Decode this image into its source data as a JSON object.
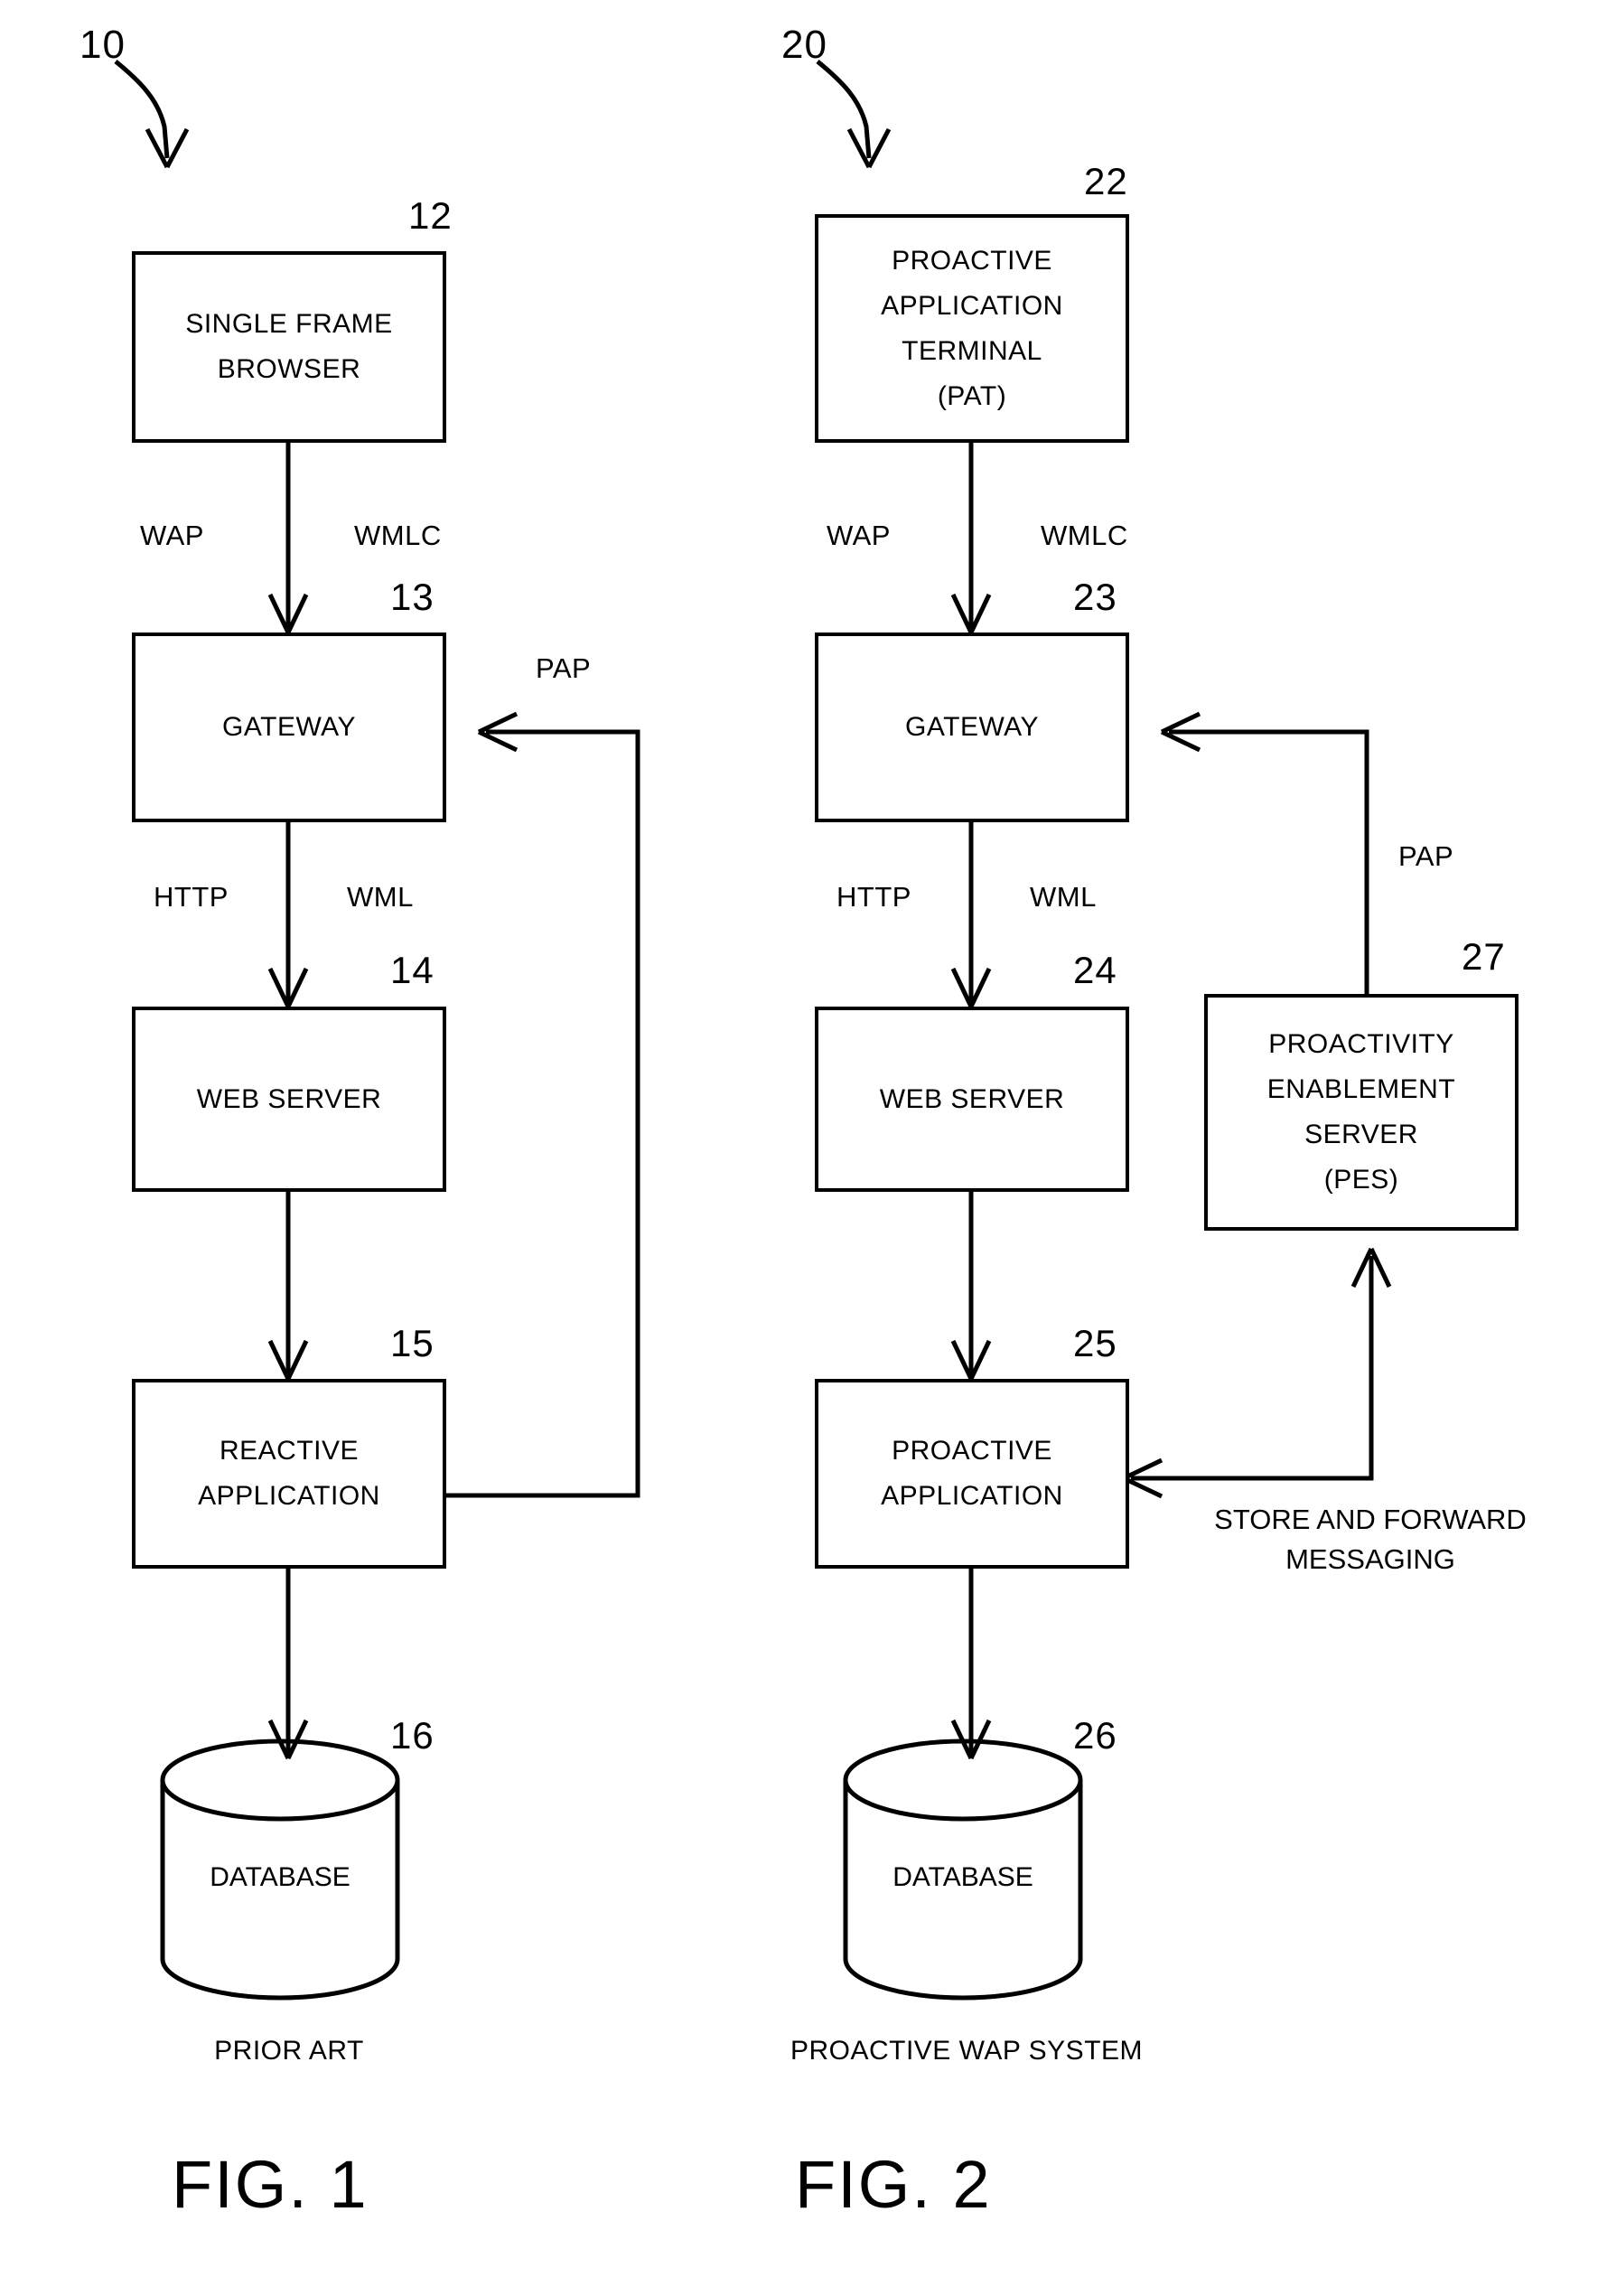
{
  "figures": [
    {
      "id": "fig1",
      "lead_ref": "10",
      "caption": "PRIOR ART",
      "title": "FIG. 1",
      "nodes": [
        {
          "id": "browser",
          "ref": "12",
          "lines": [
            "SINGLE FRAME",
            "BROWSER"
          ]
        },
        {
          "id": "gateway",
          "ref": "13",
          "lines": [
            "GATEWAY"
          ]
        },
        {
          "id": "webserver",
          "ref": "14",
          "lines": [
            "WEB SERVER"
          ]
        },
        {
          "id": "app",
          "ref": "15",
          "lines": [
            "REACTIVE",
            "APPLICATION"
          ]
        },
        {
          "id": "database",
          "ref": "16",
          "lines": [
            "DATABASE"
          ]
        }
      ],
      "edge_labels": [
        {
          "id": "wap",
          "text": "WAP"
        },
        {
          "id": "wmlc",
          "text": "WMLC"
        },
        {
          "id": "http",
          "text": "HTTP"
        },
        {
          "id": "wml",
          "text": "WML"
        },
        {
          "id": "pap",
          "text": "PAP"
        }
      ]
    },
    {
      "id": "fig2",
      "lead_ref": "20",
      "caption": "PROACTIVE WAP SYSTEM",
      "title": "FIG. 2",
      "nodes": [
        {
          "id": "pat",
          "ref": "22",
          "lines": [
            "PROACTIVE",
            "APPLICATION",
            "TERMINAL",
            "(PAT)"
          ]
        },
        {
          "id": "gateway",
          "ref": "23",
          "lines": [
            "GATEWAY"
          ]
        },
        {
          "id": "webserver",
          "ref": "24",
          "lines": [
            "WEB SERVER"
          ]
        },
        {
          "id": "app",
          "ref": "25",
          "lines": [
            "PROACTIVE",
            "APPLICATION"
          ]
        },
        {
          "id": "database",
          "ref": "26",
          "lines": [
            "DATABASE"
          ]
        },
        {
          "id": "pes",
          "ref": "27",
          "lines": [
            "PROACTIVITY",
            "ENABLEMENT",
            "SERVER",
            "(PES)"
          ]
        }
      ],
      "edge_labels": [
        {
          "id": "wap",
          "text": "WAP"
        },
        {
          "id": "wmlc",
          "text": "WMLC"
        },
        {
          "id": "http",
          "text": "HTTP"
        },
        {
          "id": "wml",
          "text": "WML"
        },
        {
          "id": "pap",
          "text": "PAP"
        },
        {
          "id": "storeforward",
          "text": "STORE AND FORWARD\nMESSAGING"
        }
      ]
    }
  ],
  "colors": {
    "ink": "#000000",
    "paper": "#ffffff"
  }
}
